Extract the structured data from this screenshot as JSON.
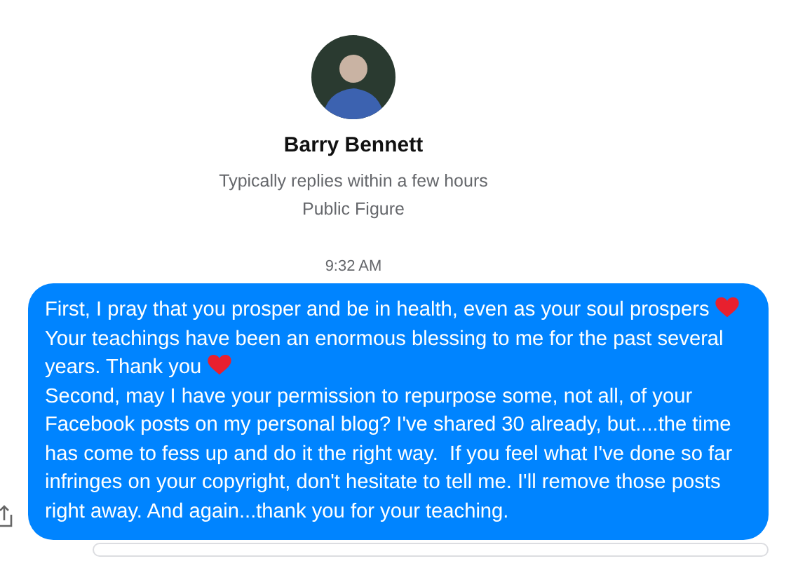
{
  "profile": {
    "name": "Barry Bennett",
    "response_time": "Typically replies within a few hours",
    "category": "Public Figure"
  },
  "timestamp": "9:32 AM",
  "message": {
    "paragraphs": [
      [
        {
          "kind": "text",
          "text": "First, I pray that you prosper and be in health, even as your soul prospers "
        },
        {
          "kind": "heart"
        },
        {
          "kind": "text",
          "text": " Your teachings have been an enormous blessing to me for the past several years. Thank you "
        },
        {
          "kind": "heart"
        }
      ],
      [
        {
          "kind": "text",
          "text": "Second, may I have your permission to repurpose some, not all, of your Facebook posts on my personal blog? I've shared 30 already, but....the time has come to fess up and do it the right way.  If you feel what I've done so far infringes on your copyright, don't hesitate to tell me. I'll remove those posts right away. And again...thank you for your teaching."
        }
      ]
    ]
  }
}
